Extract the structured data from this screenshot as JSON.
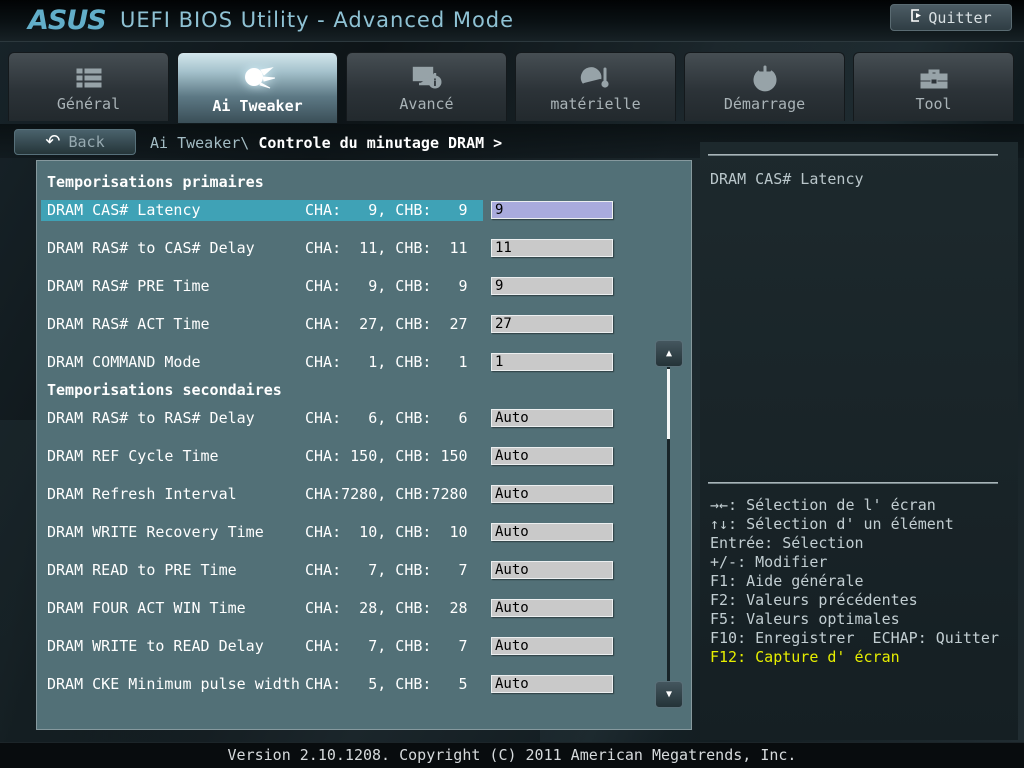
{
  "header": {
    "brand": "ASUS",
    "title": "UEFI BIOS Utility - Advanced Mode",
    "exit_label": "Quitter"
  },
  "tabs": [
    {
      "label": "Général",
      "icon": "list-icon",
      "active": false
    },
    {
      "label": "Ai Tweaker",
      "icon": "comet-icon",
      "active": true
    },
    {
      "label": "Avancé",
      "icon": "monitor-info-icon",
      "active": false
    },
    {
      "label": "matérielle",
      "icon": "gauge-icon",
      "active": false
    },
    {
      "label": "Démarrage",
      "icon": "power-icon",
      "active": false
    },
    {
      "label": "Tool",
      "icon": "toolbox-icon",
      "active": false
    }
  ],
  "breadcrumb": {
    "back_label": "Back",
    "path_prefix": "Ai Tweaker\\ ",
    "path_current": "Controle du minutage DRAM >"
  },
  "main": {
    "sections": [
      {
        "heading": "Temporisations primaires",
        "rows": [
          {
            "label": "DRAM CAS# Latency",
            "channels": "CHA:   9, CHB:   9",
            "value": "9",
            "selected": true
          },
          {
            "label": "DRAM RAS# to CAS# Delay",
            "channels": "CHA:  11, CHB:  11",
            "value": "11"
          },
          {
            "label": "DRAM RAS# PRE Time",
            "channels": "CHA:   9, CHB:   9",
            "value": "9"
          },
          {
            "label": "DRAM RAS# ACT Time",
            "channels": "CHA:  27, CHB:  27",
            "value": "27"
          },
          {
            "label": "DRAM COMMAND Mode",
            "channels": "CHA:   1, CHB:   1",
            "value": "1"
          }
        ]
      },
      {
        "heading": "Temporisations secondaires",
        "rows": [
          {
            "label": "DRAM RAS# to RAS# Delay",
            "channels": "CHA:   6, CHB:   6",
            "value": "Auto"
          },
          {
            "label": "DRAM REF Cycle Time",
            "channels": "CHA: 150, CHB: 150",
            "value": "Auto"
          },
          {
            "label": "DRAM Refresh Interval",
            "channels": "CHA:7280, CHB:7280",
            "value": "Auto"
          },
          {
            "label": "DRAM WRITE Recovery Time",
            "channels": "CHA:  10, CHB:  10",
            "value": "Auto"
          },
          {
            "label": "DRAM READ to PRE Time",
            "channels": "CHA:   7, CHB:   7",
            "value": "Auto"
          },
          {
            "label": "DRAM FOUR ACT WIN Time",
            "channels": "CHA:  28, CHB:  28",
            "value": "Auto"
          },
          {
            "label": "DRAM WRITE to READ Delay",
            "channels": "CHA:   7, CHB:   7",
            "value": "Auto"
          },
          {
            "label": "DRAM CKE Minimum pulse width",
            "channels": "CHA:   5, CHB:   5",
            "value": "Auto"
          }
        ]
      }
    ]
  },
  "sidebar": {
    "help_title": "DRAM CAS# Latency",
    "shortcuts": [
      "→←: Sélection de l' écran",
      "↑↓: Sélection d' un élément",
      "Entrée: Sélection",
      "+/-: Modifier",
      "F1: Aide générale",
      "F2: Valeurs précédentes",
      "F5: Valeurs optimales",
      "F10: Enregistrer  ECHAP: Quitter",
      "F12: Capture d' écran"
    ]
  },
  "footer": {
    "text": "Version 2.10.1208. Copyright (C) 2011 American Megatrends, Inc."
  },
  "colors": {
    "accent_teal": "#3fa2b6",
    "panel": "#527077",
    "input": "#c9c9c9",
    "selected_input": "#a9abdd",
    "f12_highlight": "#e6ee00",
    "logo_blue": "#62aec9"
  }
}
